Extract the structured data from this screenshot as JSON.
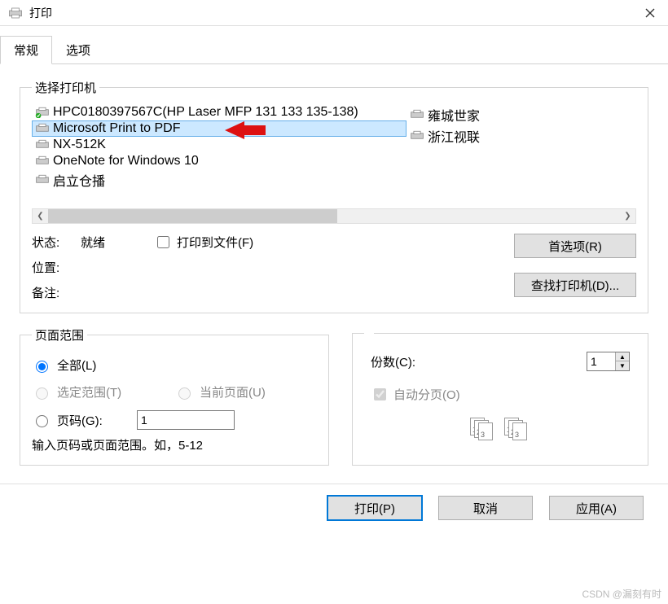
{
  "window": {
    "title": "打印"
  },
  "tabs": [
    {
      "label": "常规"
    },
    {
      "label": "选项"
    }
  ],
  "printer_section": {
    "legend": "选择打印机",
    "printers_left": [
      "HPC0180397567C(HP Laser MFP 131 133 135-138)",
      "Microsoft Print to PDF",
      "NX-512K",
      "OneNote for Windows 10",
      "启立仓播"
    ],
    "printers_right": [
      "雍城世家",
      "浙江视联"
    ],
    "selected_index": 1,
    "status_label": "状态:",
    "status_value": "就绪",
    "location_label": "位置:",
    "comment_label": "备注:",
    "print_to_file": "打印到文件(F)",
    "preferences_btn": "首选项(R)",
    "find_printer_btn": "查找打印机(D)..."
  },
  "range_section": {
    "legend": "页面范围",
    "all": "全部(L)",
    "selection": "选定范围(T)",
    "current": "当前页面(U)",
    "pages": "页码(G):",
    "pages_value": "1",
    "hint": "输入页码或页面范围。如，5-12"
  },
  "copies_section": {
    "copies_label": "份数(C):",
    "copies_value": "1",
    "collate": "自动分页(O)"
  },
  "buttons": {
    "print": "打印(P)",
    "cancel": "取消",
    "apply": "应用(A)"
  },
  "watermark": "CSDN @漏刻有时"
}
